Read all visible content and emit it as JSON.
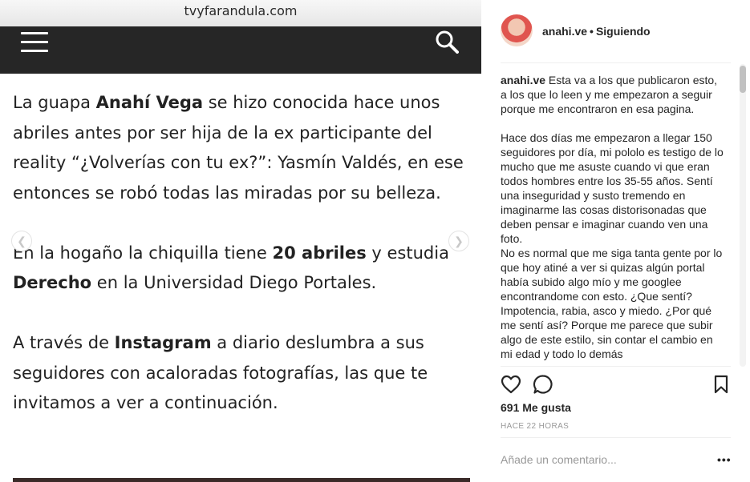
{
  "browser": {
    "url": "tvyfarandula.com"
  },
  "article": {
    "p1": {
      "t1": "La guapa ",
      "b1": "Anahí Vega",
      "t2": " se hizo conocida hace unos abriles antes por ser hija de la ex participante del reality “¿Volverías con tu ex?”: Yasmín Valdés, en ese entonces se robó todas las miradas por su belleza."
    },
    "p2": {
      "t1": "En la hogaño la chiquilla tiene ",
      "b1": "20 abriles",
      "t2": " y estudia ",
      "b2": "Derecho",
      "t3": " en la Universidad Diego Portales."
    },
    "p3": {
      "t1": "A través de ",
      "b1": "Instagram",
      "t2": " a diario deslumbra a sus seguidores con acaloradas fotografías, las que te invitamos a ver a continuación."
    }
  },
  "instagram": {
    "username": "anahi.ve",
    "separator": "•",
    "follow_status": "Siguiendo",
    "caption": {
      "username": "anahi.ve",
      "line1": "Esta va a los que publicaron esto, a los que lo leen y me empezaron a seguir porque me encontraron en esa pagina.",
      "para2": "Hace dos días me empezaron a llegar 150 seguidores por día, mi pololo es testigo de lo mucho que me asuste cuando vi que eran todos hombres entre los 35-55 años. Sentí una inseguridad y susto tremendo en imaginarme las cosas distorisonadas que deben pensar e imaginar cuando ven una foto.",
      "para3": "No es normal que me siga tanta gente por lo que hoy atiné a ver si quizas algún portal había subido algo mío y me googlee encontrandome con esto. ¿Que sentí? Impotencia, rabia, asco y miedo. ¿Por qué me sentí así? Porque me parece que subir algo de este estilo, sin contar el cambio en mi edad y todo lo demás"
    },
    "likes": "691 Me gusta",
    "time_ago": "HACE 22 HORAS",
    "add_comment_placeholder": "Añade un comentario...",
    "more_label": "•••",
    "icons": [
      "heart-icon",
      "comment-icon",
      "bookmark-icon",
      "hamburger-menu-icon",
      "search-icon"
    ]
  }
}
